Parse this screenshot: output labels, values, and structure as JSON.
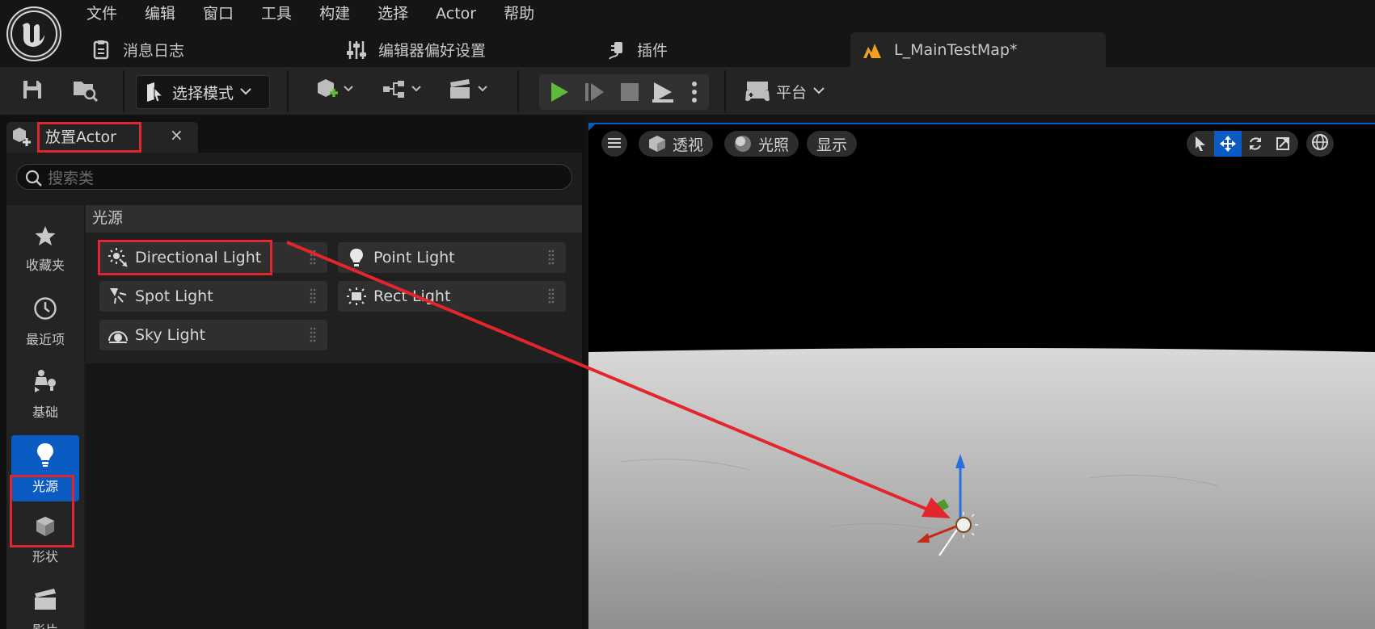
{
  "menu": [
    "文件",
    "编辑",
    "窗口",
    "工具",
    "构建",
    "选择",
    "Actor",
    "帮助"
  ],
  "tabs": {
    "message_log": "消息日志",
    "editor_prefs": "编辑器偏好设置",
    "plugins": "插件",
    "map": "L_MainTestMap*"
  },
  "toolbar": {
    "mode_label": "选择模式",
    "platform_label": "平台"
  },
  "place_actor": {
    "title": "放置Actor",
    "close": "×",
    "search_placeholder": "搜索类",
    "categories": [
      {
        "label": "收藏夹",
        "icon": "star-icon"
      },
      {
        "label": "最近项",
        "icon": "clock-icon"
      },
      {
        "label": "基础",
        "icon": "basic-shapes-icon"
      },
      {
        "label": "光源",
        "icon": "lightbulb-icon"
      },
      {
        "label": "形状",
        "icon": "cube-icon"
      },
      {
        "label": "影片",
        "icon": "clapperboard-icon"
      }
    ],
    "section_title": "光源",
    "items": [
      {
        "label": "Directional Light",
        "icon": "directional-light-icon"
      },
      {
        "label": "Point Light",
        "icon": "point-light-icon"
      },
      {
        "label": "Spot Light",
        "icon": "spot-light-icon"
      },
      {
        "label": "Rect Light",
        "icon": "rect-light-icon"
      },
      {
        "label": "Sky Light",
        "icon": "sky-light-icon"
      }
    ]
  },
  "viewport": {
    "perspective": "透视",
    "lighting": "光照",
    "show": "显示"
  },
  "colors": {
    "accent": "#0a5cc2",
    "highlight": "#e3262d",
    "play": "#5fb93a"
  }
}
